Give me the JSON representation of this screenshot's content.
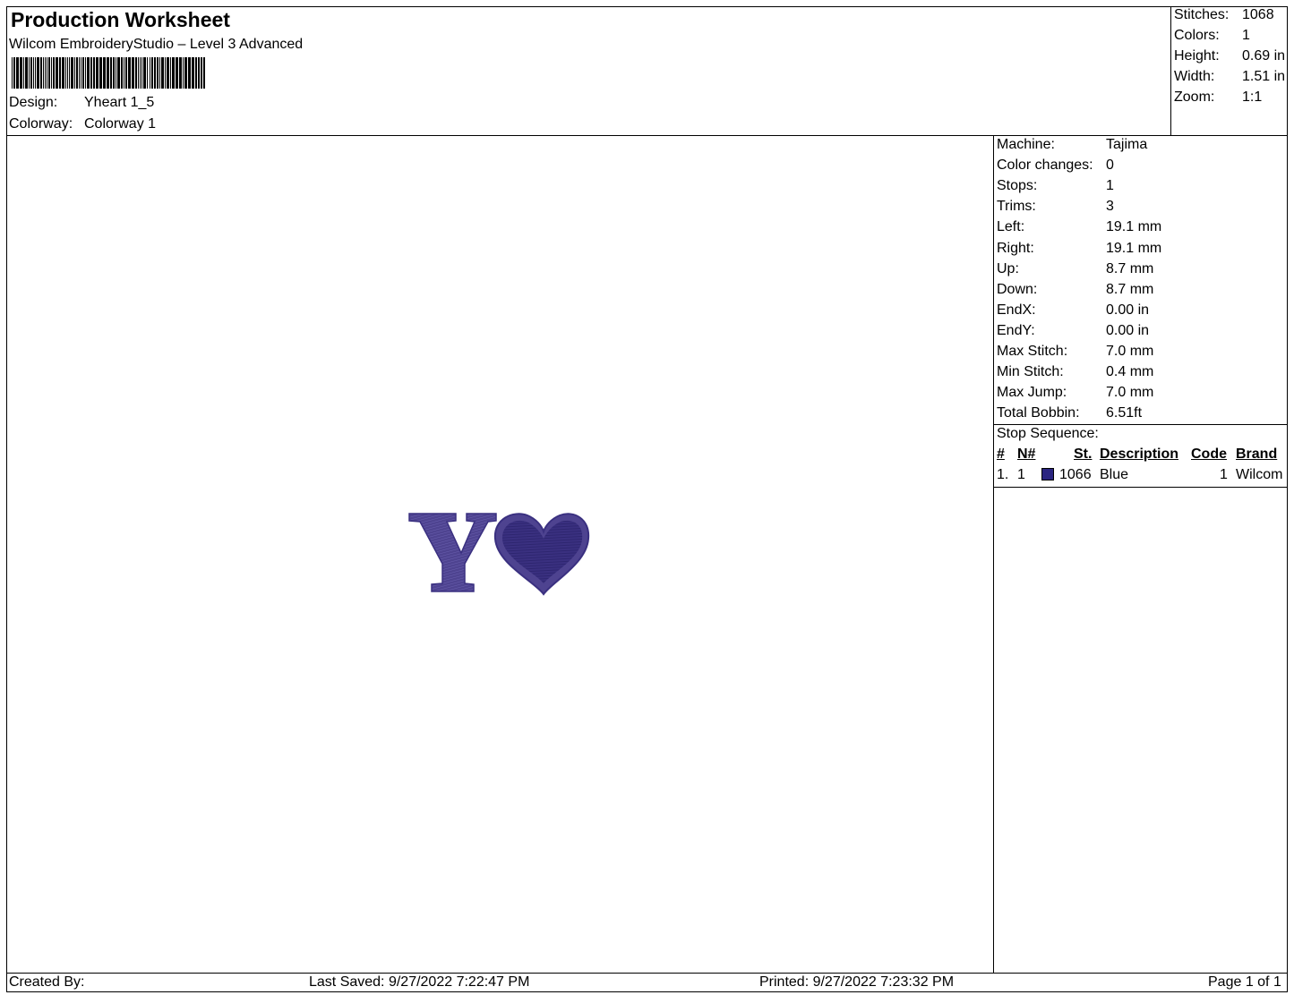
{
  "header": {
    "title": "Production Worksheet",
    "subtitle": "Wilcom EmbroideryStudio – Level 3 Advanced",
    "design_label": "Design:",
    "design_value": "Yheart 1_5",
    "colorway_label": "Colorway:",
    "colorway_value": "Colorway 1"
  },
  "summary": {
    "stitches_label": "Stitches:",
    "stitches_value": "1068",
    "colors_label": "Colors:",
    "colors_value": "1",
    "height_label": "Height:",
    "height_value": "0.69 in",
    "width_label": "Width:",
    "width_value": "1.51 in",
    "zoom_label": "Zoom:",
    "zoom_value": "1:1"
  },
  "machine_info": [
    {
      "label": "Machine:",
      "value": "Tajima"
    },
    {
      "label": "Color changes:",
      "value": "0"
    },
    {
      "label": "Stops:",
      "value": "1"
    },
    {
      "label": "Trims:",
      "value": "3"
    },
    {
      "label": "Left:",
      "value": "19.1 mm"
    },
    {
      "label": "Right:",
      "value": "19.1 mm"
    },
    {
      "label": "Up:",
      "value": "8.7 mm"
    },
    {
      "label": "Down:",
      "value": "8.7 mm"
    },
    {
      "label": "EndX:",
      "value": "0.00 in"
    },
    {
      "label": "EndY:",
      "value": "0.00 in"
    },
    {
      "label": "Max Stitch:",
      "value": "7.0 mm"
    },
    {
      "label": "Min Stitch:",
      "value": "0.4 mm"
    },
    {
      "label": "Max Jump:",
      "value": "7.0 mm"
    },
    {
      "label": "Total Bobbin:",
      "value": "6.51ft"
    }
  ],
  "stop_sequence": {
    "title": "Stop Sequence:",
    "headers": {
      "num": "#",
      "n_num": "N#",
      "st": "St.",
      "description": "Description",
      "code": "Code",
      "brand": "Brand"
    },
    "rows": [
      {
        "num": "1.",
        "n_num": "1",
        "color": "#2a2480",
        "st": "1066",
        "description": "Blue",
        "code": "1",
        "brand": "Wilcom"
      }
    ]
  },
  "design_colors": {
    "thread": "#4e4390",
    "thread_dark": "#3a3080"
  },
  "footer": {
    "created_by": "Created By:",
    "last_saved": "Last Saved: 9/27/2022 7:22:47 PM",
    "printed": "Printed: 9/27/2022 7:23:32 PM",
    "page": "Page 1 of 1"
  }
}
